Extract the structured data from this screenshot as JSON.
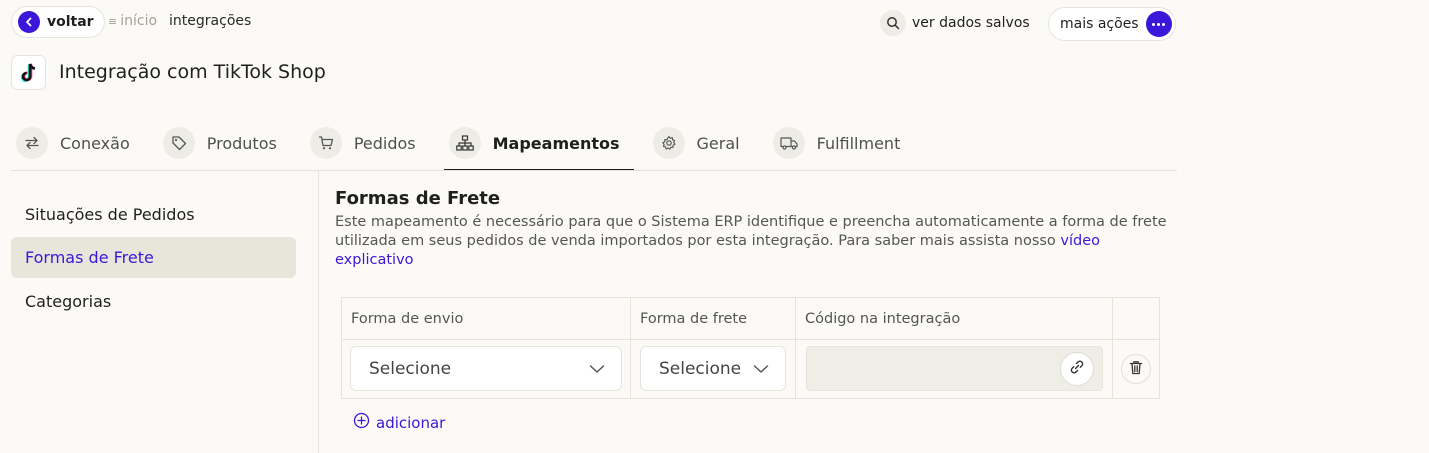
{
  "topbar": {
    "back_label": "voltar",
    "breadcrumb_home": "início",
    "breadcrumb_current": "integrações",
    "saved_data_label": "ver dados salvos",
    "more_actions_label": "mais ações"
  },
  "header": {
    "title": "Integração com TikTok Shop",
    "logo_icon": "tiktok-logo"
  },
  "tabs": [
    {
      "label": "Conexão",
      "icon": "arrows-swap-icon"
    },
    {
      "label": "Produtos",
      "icon": "tag-icon"
    },
    {
      "label": "Pedidos",
      "icon": "cart-icon"
    },
    {
      "label": "Mapeamentos",
      "icon": "hierarchy-icon",
      "active": true
    },
    {
      "label": "Geral",
      "icon": "gear-icon"
    },
    {
      "label": "Fulfillment",
      "icon": "truck-icon"
    }
  ],
  "sidebar": {
    "items": [
      {
        "label": "Situações de Pedidos"
      },
      {
        "label": "Formas de Frete",
        "active": true
      },
      {
        "label": "Categorias"
      }
    ]
  },
  "main": {
    "title": "Formas de Frete",
    "description": "Este mapeamento é necessário para que o Sistema ERP identifique e preencha automaticamente a forma de frete utilizada em seus pedidos de venda importados por esta integração. Para saber mais assista nosso ",
    "video_link": "vídeo explicativo",
    "table": {
      "columns": [
        "Forma de envio",
        "Forma de frete",
        "Código na integração"
      ],
      "row": {
        "shipping_method": "Selecione",
        "freight_method": "Selecione",
        "integration_code": ""
      }
    },
    "add_label": "adicionar"
  },
  "colors": {
    "accent": "#3b17d9",
    "background": "#fbfaf6",
    "sidebar_active": "#e8e6db"
  }
}
